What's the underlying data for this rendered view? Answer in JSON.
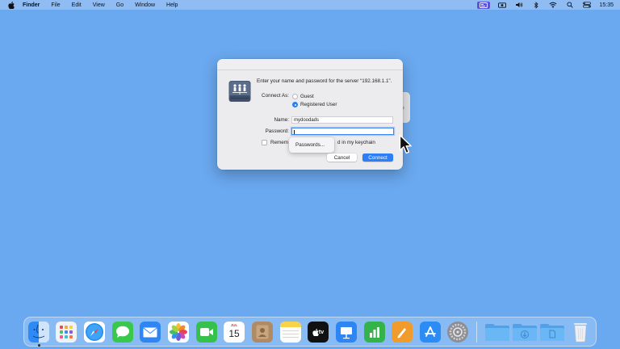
{
  "menubar": {
    "app_name": "Finder",
    "items": [
      "File",
      "Edit",
      "View",
      "Go",
      "Window",
      "Help"
    ],
    "status_icons": [
      "screen-mirror-icon",
      "camera-icon",
      "volume-icon",
      "bluetooth-icon",
      "wifi-icon",
      "search-icon",
      "control-center-icon"
    ],
    "clock": "15:35"
  },
  "dialog": {
    "prompt": "Enter your name and password for the server “192.168.1.1”.",
    "connect_as_label": "Connect As:",
    "guest_label": "Guest",
    "registered_label": "Registered User",
    "selected_option": "Registered User",
    "name_label": "Name:",
    "name_value": "mydoodads",
    "password_label": "Password:",
    "password_value": "",
    "remember_label_left": "Remem",
    "remember_label_right": "d in my keychain",
    "remember_checked": false,
    "popover_label": "Passwords...",
    "cancel_label": "Cancel",
    "connect_label": "Connect",
    "accent_color": "#2d7ff6"
  },
  "dock": {
    "calendar_month": "JUL",
    "calendar_day": "15",
    "tv_label": "tv",
    "apps": [
      "Finder",
      "Launchpad",
      "Safari",
      "Messages",
      "Mail",
      "Photos",
      "FaceTime",
      "Calendar",
      "Contacts",
      "Notes",
      "TV",
      "Keynote",
      "Numbers",
      "Pages",
      "App Store",
      "System Settings",
      "Applications",
      "Downloads",
      "Documents",
      "Trash"
    ]
  },
  "colors": {
    "desktop": "#6aa8ef",
    "menubar": "#8ebcf3"
  }
}
